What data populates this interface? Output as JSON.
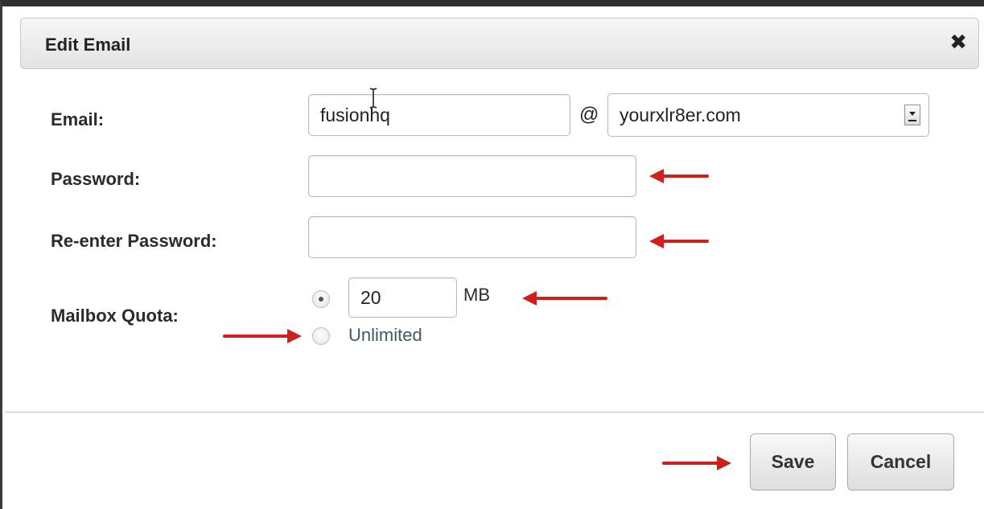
{
  "dialog": {
    "title": "Edit Email",
    "close_icon": "close-icon"
  },
  "form": {
    "email_label": "Email:",
    "email_local_value": "fusionhq",
    "at_sign": "@",
    "domain_selected": "yourxlr8er.com",
    "password_label": "Password:",
    "password_value": "",
    "reenter_password_label": "Re-enter Password:",
    "reenter_password_value": "",
    "quota_label": "Mailbox Quota:",
    "quota_value": "20",
    "quota_unit": "MB",
    "unlimited_label": "Unlimited",
    "quota_mode_selected": "MB"
  },
  "footer": {
    "save_label": "Save",
    "cancel_label": "Cancel"
  },
  "annotation_arrows": {
    "color": "#d0201c",
    "targets": [
      "password-input",
      "reenter-password-input",
      "quota-input",
      "unlimited-radio",
      "save-button"
    ]
  }
}
